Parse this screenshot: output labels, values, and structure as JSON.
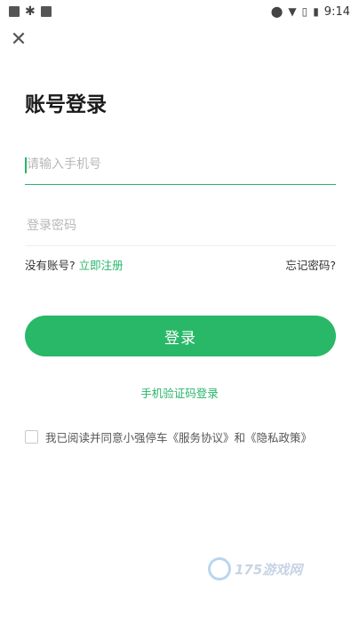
{
  "status_bar": {
    "time": "9:14",
    "left_icons": [
      "square-icon",
      "bug-icon",
      "square-icon"
    ],
    "right_icons": [
      "location-icon",
      "wifi-icon",
      "no-sim-icon",
      "battery-icon"
    ]
  },
  "page": {
    "title": "账号登录"
  },
  "form": {
    "phone_placeholder": "请输入手机号",
    "password_placeholder": "登录密码"
  },
  "links": {
    "no_account": "没有账号?",
    "register": "立即注册",
    "forgot": "忘记密码?"
  },
  "login_button": "登录",
  "sms_login": "手机验证码登录",
  "agreement": "我已阅读并同意小强停车《服务协议》和《隐私政策》",
  "watermark": "175游戏网",
  "colors": {
    "accent": "#28b868"
  }
}
